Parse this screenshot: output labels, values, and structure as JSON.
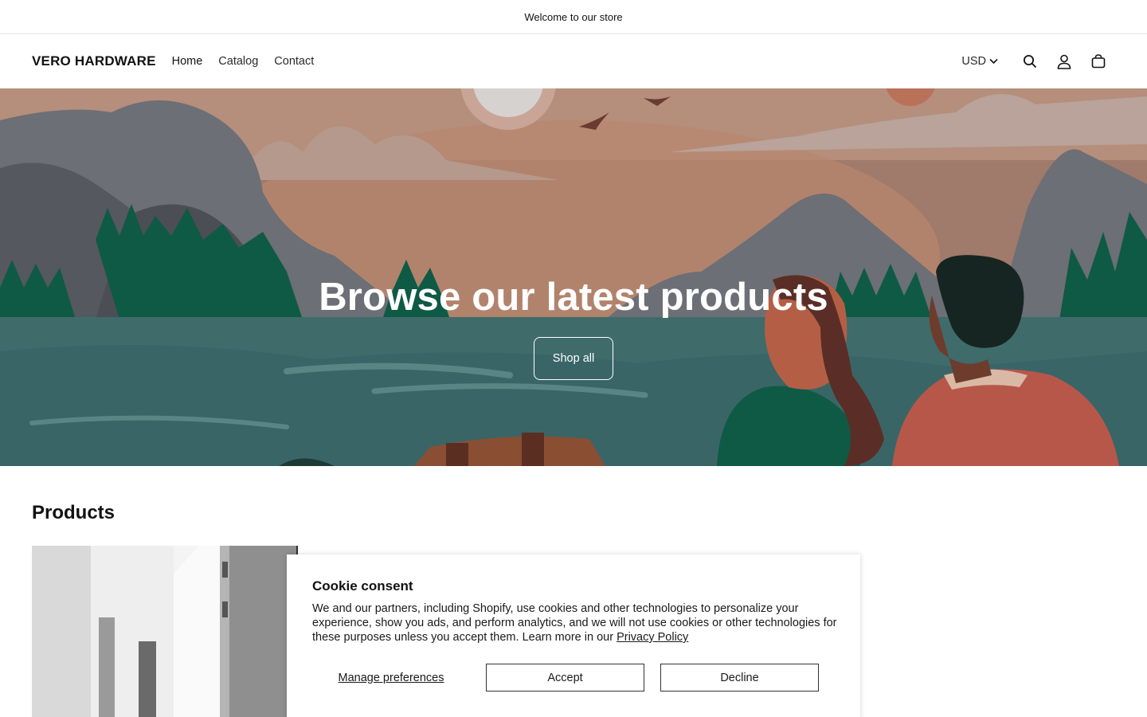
{
  "announcement": {
    "text": "Welcome to our store"
  },
  "header": {
    "logo": "VERO HARDWARE",
    "nav": [
      {
        "label": "Home"
      },
      {
        "label": "Catalog"
      },
      {
        "label": "Contact"
      }
    ],
    "currency": "USD",
    "icons": [
      "search-icon",
      "account-icon",
      "cart-icon"
    ]
  },
  "hero": {
    "title": "Browse our latest products",
    "button": "Shop all"
  },
  "products": {
    "heading": "Products"
  },
  "cookie": {
    "title": "Cookie consent",
    "text": "We and our partners, including Shopify, use cookies and other technologies to personalize your experience, show you ads, and perform analytics, and we will not use cookies or other technologies for these purposes unless you accept them. Learn more in our",
    "link": "Privacy Policy",
    "manage": "Manage preferences",
    "accept": "Accept",
    "decline": "Decline"
  },
  "colors": {
    "sky": "#a07a6a",
    "water": "#3f6b6b",
    "forest": "#0f5a45",
    "mountain": "#6c6f75",
    "text": "#121212"
  }
}
